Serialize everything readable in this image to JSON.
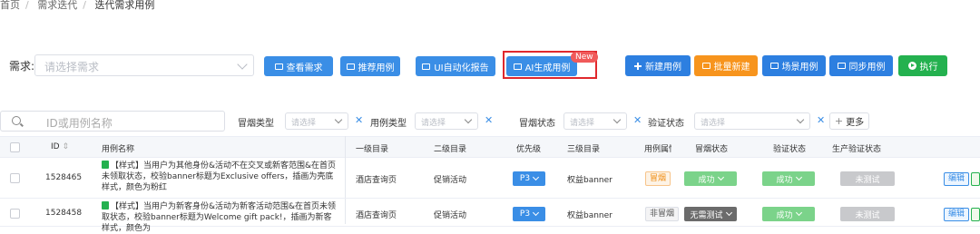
{
  "breadcrumb": [
    "首页",
    "需求迭代",
    "迭代需求用例"
  ],
  "requirement": {
    "label": "需求:",
    "placeholder": "请选择需求"
  },
  "toolbar": {
    "query_req": "查看需求",
    "recommend": "推荐用例",
    "ui_report": "UI自动化报告",
    "ai_generate": "AI生成用例",
    "new_badge": "New",
    "new_case": "新建用例",
    "batch_new": "批量新建",
    "scene_case": "场景用例",
    "sync_case": "同步用例",
    "execute": "执行"
  },
  "filters": {
    "search_placeholder": "ID或用例名称",
    "smoke_type": {
      "label": "冒烟类型",
      "placeholder": "请选择"
    },
    "case_type": {
      "label": "用例类型",
      "placeholder": "请选择"
    },
    "smoke_status": {
      "label": "冒烟状态",
      "placeholder": "请选择"
    },
    "verify_status": {
      "label": "验证状态",
      "placeholder": "请选择"
    },
    "more": "更多"
  },
  "table": {
    "headers": {
      "id": "ID",
      "name": "用例名称",
      "level1": "一级目录",
      "level2": "二级目录",
      "priority": "优先级",
      "level3": "三级目录",
      "case_tag": "用例属性",
      "smoke_status": "冒烟状态",
      "verify_status": "验证状态",
      "prod_verify": "生产验证状态"
    },
    "rows": [
      {
        "id": "1528465",
        "name": "【样式】当用户为其他身份&活动不在交叉或新客范围&在首页未领取状态，校验banner标题为Exclusive offers，插画为壳底样式，颜色为粉红",
        "level1": "酒店查询页",
        "level2": "促销活动",
        "priority": "P3",
        "level3": "权益banner",
        "tag": "冒烟",
        "smoke_status": "成功",
        "verify_status": "成功",
        "prod_verify": "未测试",
        "op_edit": "编辑"
      },
      {
        "id": "1528458",
        "name": "【样式】当用户为新客身份&活动为新客活动范围&在首页未领取状态，校验banner标题为Welcome gift pack!，插画为新客样式，颜色为",
        "level1": "酒店查询页",
        "level2": "促销活动",
        "priority": "P3",
        "level3": "权益banner",
        "tag": "非冒烟",
        "smoke_status": "无需测试",
        "verify_status": "成功",
        "prod_verify": "未测试",
        "op_edit": "编辑"
      }
    ]
  },
  "colors": {
    "primary": "#3a8ee6",
    "orange": "#f7941d",
    "green": "#24b14f",
    "highlight_red": "#e0282d"
  }
}
